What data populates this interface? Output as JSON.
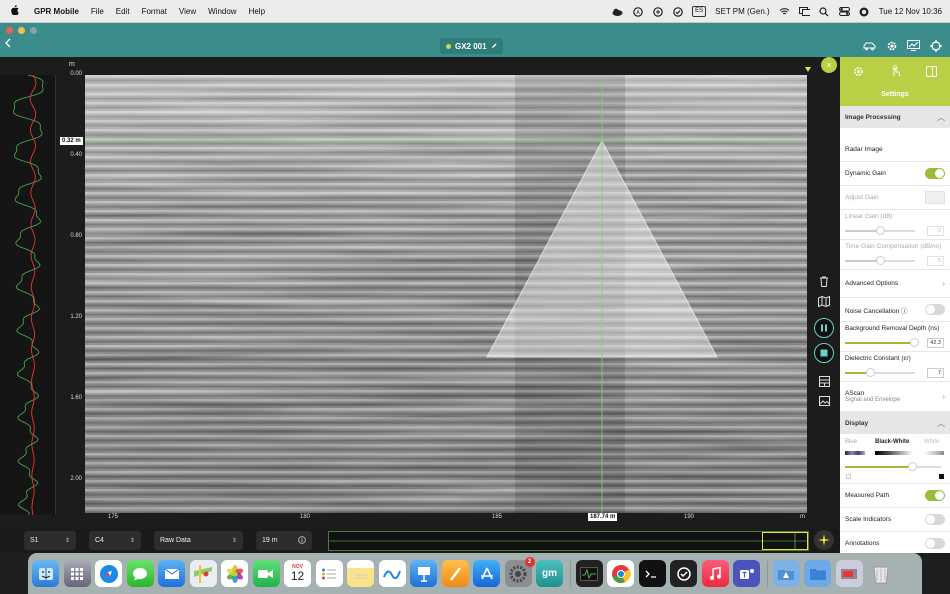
{
  "menubar": {
    "app_name": "GPR Mobile",
    "items": [
      "File",
      "Edit",
      "Format",
      "View",
      "Window",
      "Help"
    ],
    "input_source": "ES",
    "status_text": "SET PM (Gen.)",
    "datetime": "Tue 12 Nov  10:36"
  },
  "window": {
    "device_name": "GX2 001",
    "accent": "#3a8d8a"
  },
  "radar": {
    "depth_unit": "m",
    "depth_ticks": [
      "0.00",
      "0.40",
      "0.80",
      "1.20",
      "1.60",
      "2.00"
    ],
    "depth_marker": "0.32 m",
    "x_ticks": [
      "175",
      "180",
      "185",
      "190"
    ],
    "x_unit": "m",
    "x_marker": "187.74 m"
  },
  "bottombar": {
    "scan_select": "S1",
    "channel_select": "C4",
    "data_select": "Raw Data",
    "window_length": "19 m"
  },
  "settings": {
    "title": "Settings",
    "image_processing": "Image Processing",
    "radar_image": "Radar Image",
    "dynamic_gain": "Dynamic Gain",
    "dynamic_gain_on": true,
    "adjust_gain": "Adjust Gain",
    "linear_gain_label": "Linear Gain (dB)",
    "linear_gain_value": "0",
    "linear_gain_level": 0.5,
    "tgc_label": "Time Gain Compensation (dB/ns)",
    "tgc_value": "5",
    "tgc_level": 0.5,
    "advanced_options": "Advanced Options",
    "noise_cancellation": "Noise Cancellation",
    "noise_cancellation_on": false,
    "bg_removal_label": "Background Removal Depth (ns)",
    "bg_removal_value": "42.3",
    "bg_removal_level": 0.98,
    "dielectric_label": "Dielectric Constant (εr)",
    "dielectric_value": "7",
    "dielectric_level": 0.35,
    "ascan_title": "AScan",
    "ascan_sub": "Signal and Envelope",
    "display": "Display",
    "palette_blue": "Blue",
    "palette_bw": "Black-White",
    "palette_white": "White",
    "palette_level": 0.7,
    "measured_path": "Measured Path",
    "measured_path_on": true,
    "scale_indicators": "Scale Indicators",
    "scale_indicators_on": false,
    "annotations": "Annotations",
    "accent": "#b9cf45"
  },
  "dock": {
    "calendar_month": "NOV",
    "calendar_day": "12",
    "settings_badge": "2",
    "gm_label": "gm"
  }
}
